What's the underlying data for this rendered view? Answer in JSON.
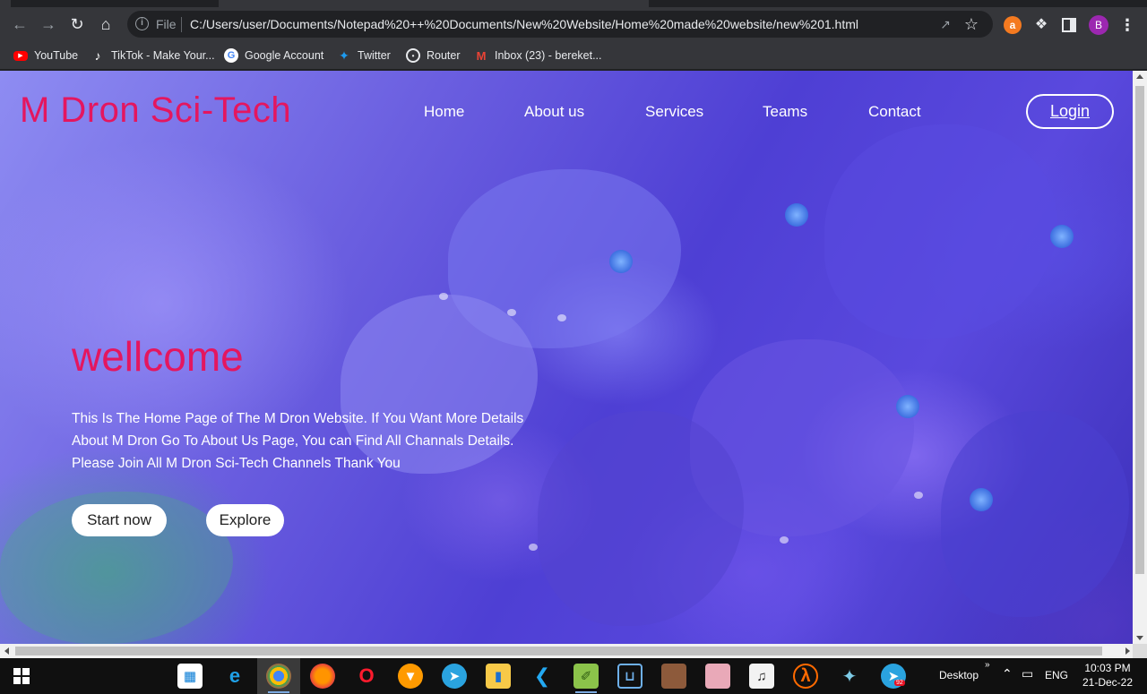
{
  "browser": {
    "url_scheme": "File",
    "url": "C:/Users/user/Documents/Notepad%20++%20Documents/New%20Website/Home%20made%20website/new%201.html",
    "profile_initial": "B",
    "bookmarks": [
      {
        "label": "YouTube",
        "icon": "youtube-icon"
      },
      {
        "label": "TikTok - Make Your...",
        "icon": "tiktok-icon"
      },
      {
        "label": "Google Account",
        "icon": "google-icon"
      },
      {
        "label": "Twitter",
        "icon": "twitter-icon"
      },
      {
        "label": "Router",
        "icon": "router-icon"
      },
      {
        "label": "Inbox (23) - bereket...",
        "icon": "gmail-icon"
      }
    ]
  },
  "page": {
    "logo": "M Dron Sci-Tech",
    "nav": [
      "Home",
      "About us",
      "Services",
      "Teams",
      "Contact"
    ],
    "login_label": "Login",
    "hero_title": "wellcome",
    "hero_lines": [
      "This Is The Home Page of The M Dron Website. If You Want More Details",
      "About M Dron Go To About Us Page, You can Find All Channals Details.",
      "Please Join All M Dron Sci-Tech Channels Thank You"
    ],
    "cta_start": "Start now",
    "cta_explore": "Explore",
    "colors": {
      "brand": "#e4165f",
      "text": "#ffffff"
    }
  },
  "taskbar": {
    "apps": [
      "windows-store-icon",
      "edge-icon",
      "chrome-icon",
      "firefox-icon",
      "opera-icon",
      "brave-icon",
      "telegram-icon",
      "file-explorer-icon",
      "vscode-icon",
      "notepad-plus-plus-icon",
      "terminal-icon",
      "photo-app-icon",
      "photo-app-2-icon",
      "music-app-icon",
      "half-life-icon",
      "game-controller-icon",
      "telegram-desktop-icon"
    ],
    "telegram_badge": "92",
    "desktop_label": "Desktop",
    "language": "ENG",
    "time": "10:03 PM",
    "date": "21-Dec-22"
  }
}
